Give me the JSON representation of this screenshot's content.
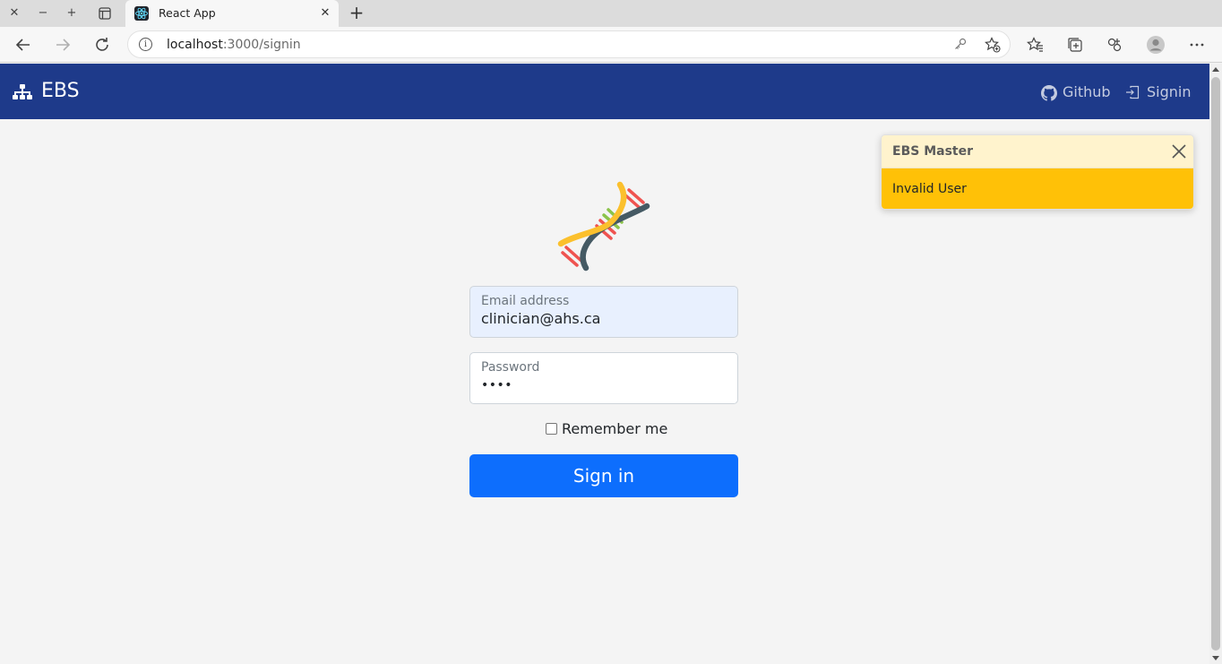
{
  "browser": {
    "tab_title": "React App",
    "url_host": "localhost",
    "url_path": ":3000/signin",
    "icons": [
      "close-window-icon",
      "minimize-icon",
      "maximize-icon",
      "tab-actions-icon",
      "react-favicon-icon",
      "tab-close-icon",
      "new-tab-icon",
      "back-icon",
      "forward-icon",
      "refresh-icon",
      "site-info-icon",
      "key-icon",
      "add-favorite-icon",
      "favorites-icon",
      "collections-icon",
      "extensions-icon",
      "profile-icon",
      "more-icon"
    ]
  },
  "navbar": {
    "brand": "EBS",
    "links": [
      {
        "label": "Github",
        "icon": "github-icon"
      },
      {
        "label": "Signin",
        "icon": "signin-icon"
      }
    ],
    "color": "#1e3a8a"
  },
  "form": {
    "email_label": "Email address",
    "email_value": "clinician@ahs.ca",
    "password_label": "Password",
    "password_value": "••••",
    "remember_label": "Remember me",
    "remember_checked": false,
    "submit_label": "Sign in",
    "submit_color": "#0d6efd"
  },
  "toast": {
    "title": "EBS Master",
    "message": "Invalid User",
    "header_color": "#fff3cd",
    "body_color": "#ffc107"
  }
}
